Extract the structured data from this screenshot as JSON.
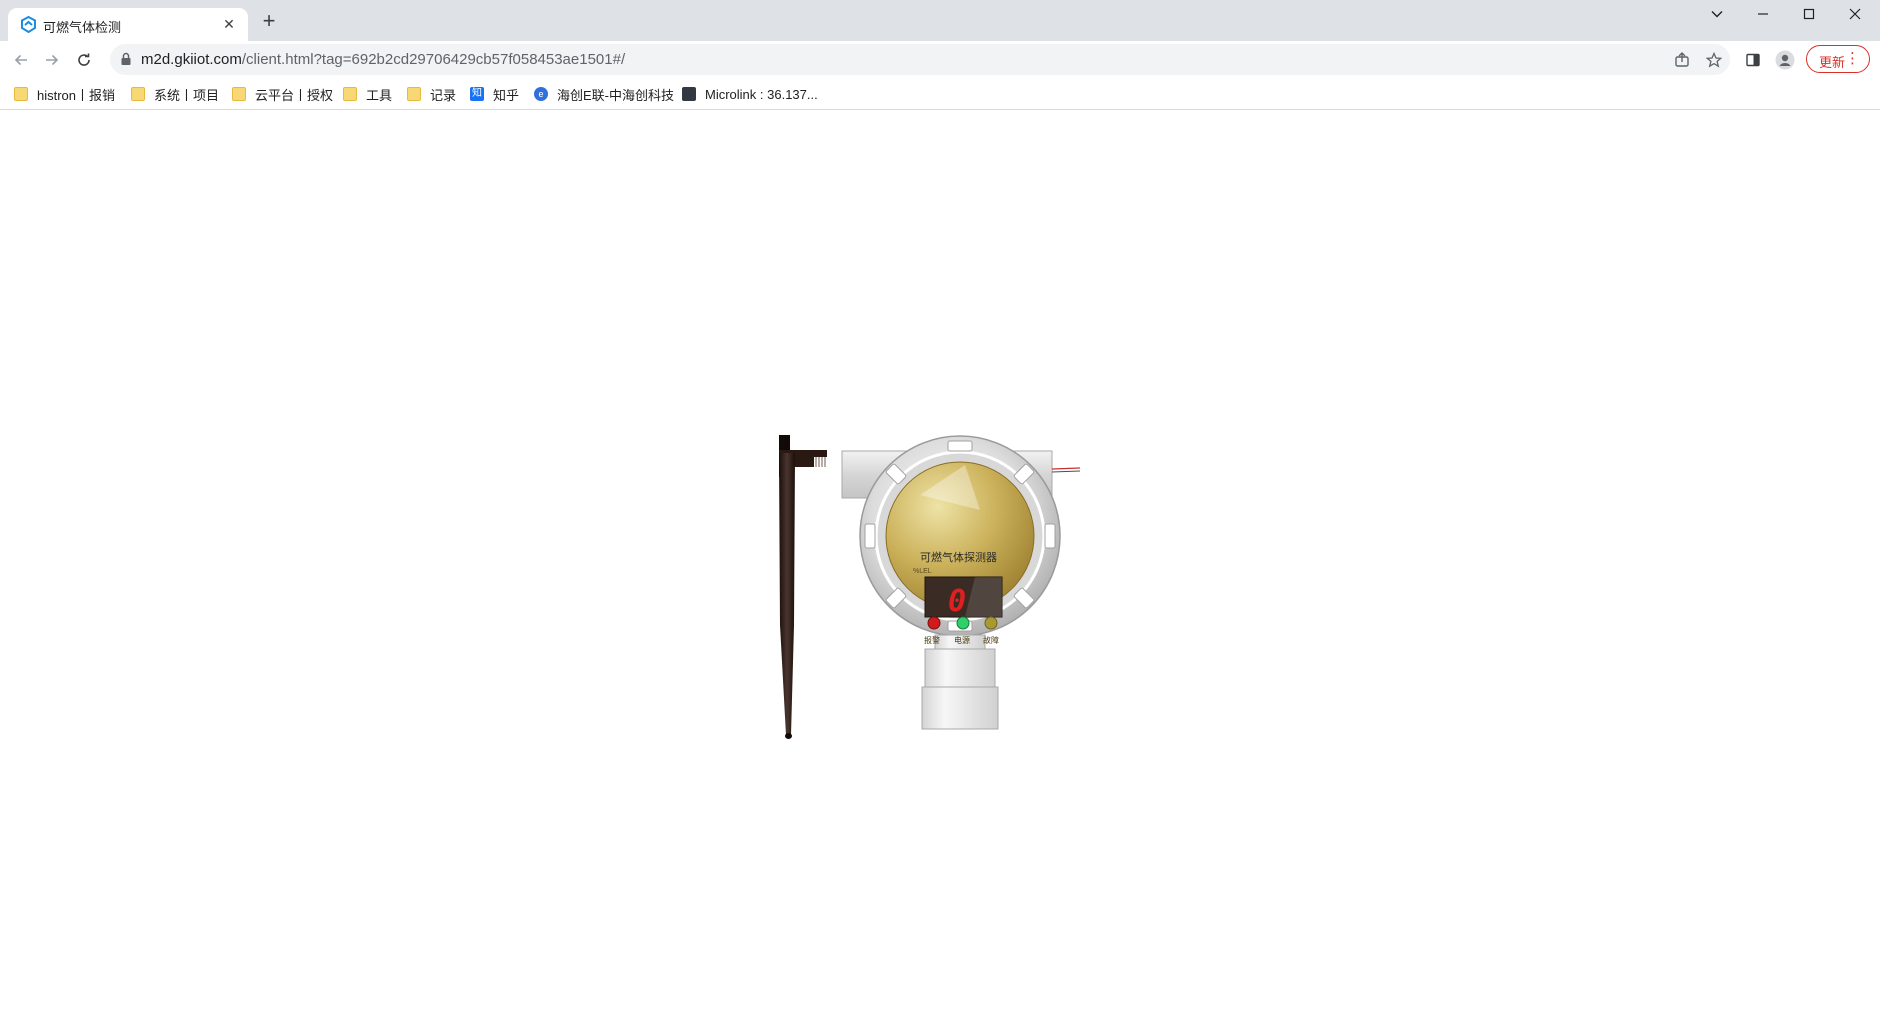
{
  "browser": {
    "tab": {
      "title": "可燃气体检测",
      "favicon": "gkiiot-logo-icon"
    },
    "url": {
      "host": "m2d.gkiiot.com",
      "path": "/client.html?tag=692b2cd29706429cb57f058453ae1501#/"
    },
    "update_label": "更新",
    "bookmarks": [
      {
        "label": "histron丨报销",
        "icon": "folder-icon"
      },
      {
        "label": "系统丨项目",
        "icon": "folder-icon"
      },
      {
        "label": "云平台丨授权",
        "icon": "folder-icon"
      },
      {
        "label": "工具",
        "icon": "folder-icon"
      },
      {
        "label": "记录",
        "icon": "folder-icon"
      },
      {
        "label": "知乎",
        "icon": "zhihu-icon"
      },
      {
        "label": "海创E联-中海创科技",
        "icon": "haichuang-icon"
      },
      {
        "label": "Microlink : 36.137...",
        "icon": "microlink-icon"
      }
    ]
  },
  "detector": {
    "title": "可燃气体探测器",
    "unit": "%LEL",
    "reading": "0",
    "indicators": [
      {
        "label": "报警",
        "color": "#d21a1a"
      },
      {
        "label": "电源",
        "color": "#2fcf6a"
      },
      {
        "label": "故障",
        "color": "#a89a30"
      }
    ]
  },
  "colors": {
    "accent_red": "#d93025",
    "digit_red": "#e02020",
    "panel_gold": "#c8ad55"
  }
}
